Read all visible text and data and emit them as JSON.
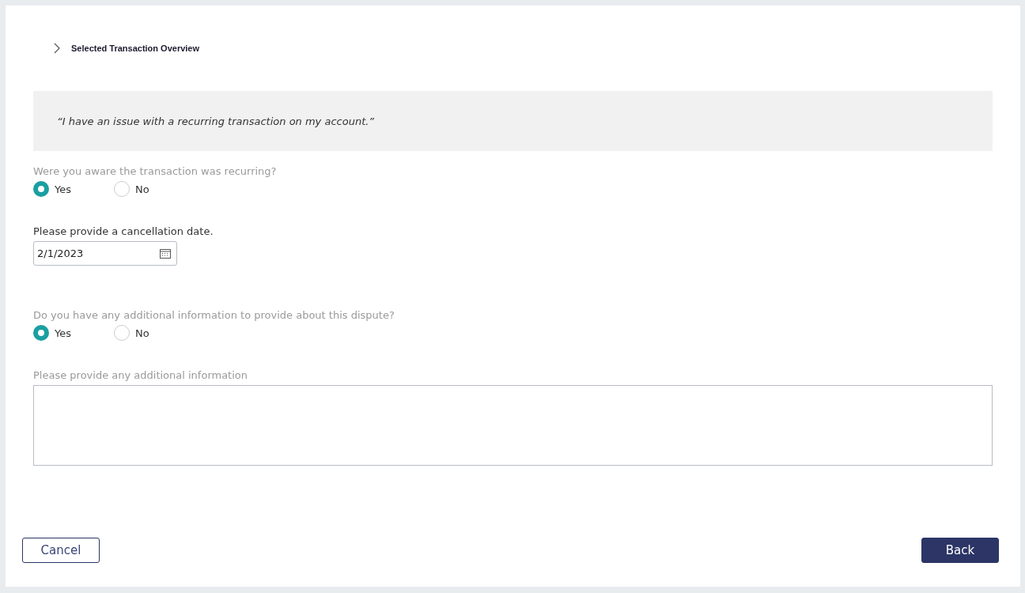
{
  "section": {
    "title": "Selected Transaction Overview",
    "expanded": false
  },
  "quote": "“I have an issue with a recurring transaction on my account.”",
  "fields": [
    {
      "kind": "radio",
      "label": "Were you aware the transaction was recurring?",
      "options": [
        {
          "label": "Yes",
          "selected": true
        },
        {
          "label": "No",
          "selected": false
        }
      ]
    },
    {
      "kind": "date",
      "label": "Please provide a cancellation date.",
      "value": "2/1/2023"
    },
    {
      "kind": "radio",
      "label": "Do you have any additional information to provide about this dispute?",
      "options": [
        {
          "label": "Yes",
          "selected": true
        },
        {
          "label": "No",
          "selected": false
        }
      ]
    },
    {
      "kind": "textarea",
      "label": "Please provide any additional information"
    }
  ],
  "buttons": {
    "secondary": "Cancel",
    "primary": "Back"
  }
}
